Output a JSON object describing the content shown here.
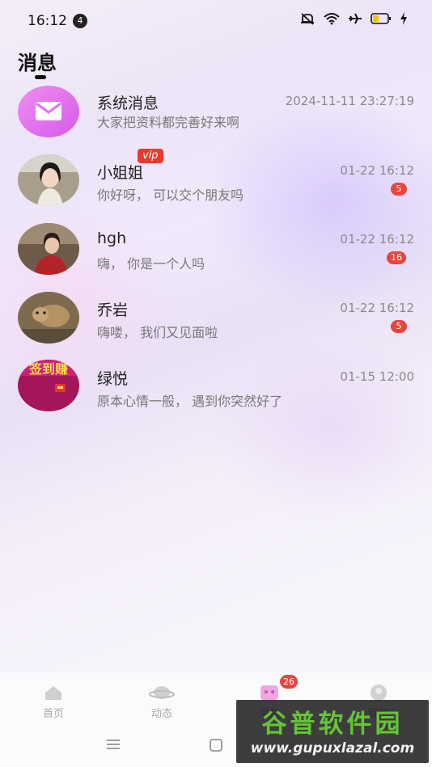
{
  "status_bar": {
    "time": "16:12",
    "notification_count": "4"
  },
  "page": {
    "title": "消息"
  },
  "conversations": [
    {
      "name": "系统消息",
      "preview": "大家把资料都完善好来啊",
      "time": "2024-11-11 23:27:19",
      "avatar": "mail-icon"
    },
    {
      "name": "小姐姐",
      "preview": "你好呀， 可以交个朋友吗",
      "time": "01-22 16:12",
      "unread": "5",
      "avatar": "user-photo"
    },
    {
      "name": "hgh",
      "vip": "vip",
      "preview": "嗨， 你是一个人吗",
      "time": "01-22 16:12",
      "unread": "16",
      "avatar": "user-photo"
    },
    {
      "name": "乔岩",
      "preview": "嗨喽， 我们又见面啦",
      "time": "01-22 16:12",
      "unread": "5",
      "avatar": "camel-photo"
    },
    {
      "name": "绿悦",
      "preview": "原本心情一般， 遇到你突然好了",
      "time": "01-15 12:00",
      "avatar": "checkin-banner",
      "avatar_text": "签到赚"
    }
  ],
  "bottom_nav": {
    "items": [
      {
        "label": "首页",
        "icon": "home-icon"
      },
      {
        "label": "动态",
        "icon": "planet-icon"
      },
      {
        "label": "消息",
        "icon": "message-icon",
        "badge": "26"
      },
      {
        "label": "我的",
        "icon": "profile-icon"
      }
    ]
  },
  "watermark": {
    "title": "谷普软件园",
    "url": "www.gupuxlazal.com"
  },
  "colors": {
    "badge": "#e8453c",
    "vip": "#ea3a2c",
    "mail_avatar": "#e676ef",
    "watermark_green": "#66c437"
  }
}
